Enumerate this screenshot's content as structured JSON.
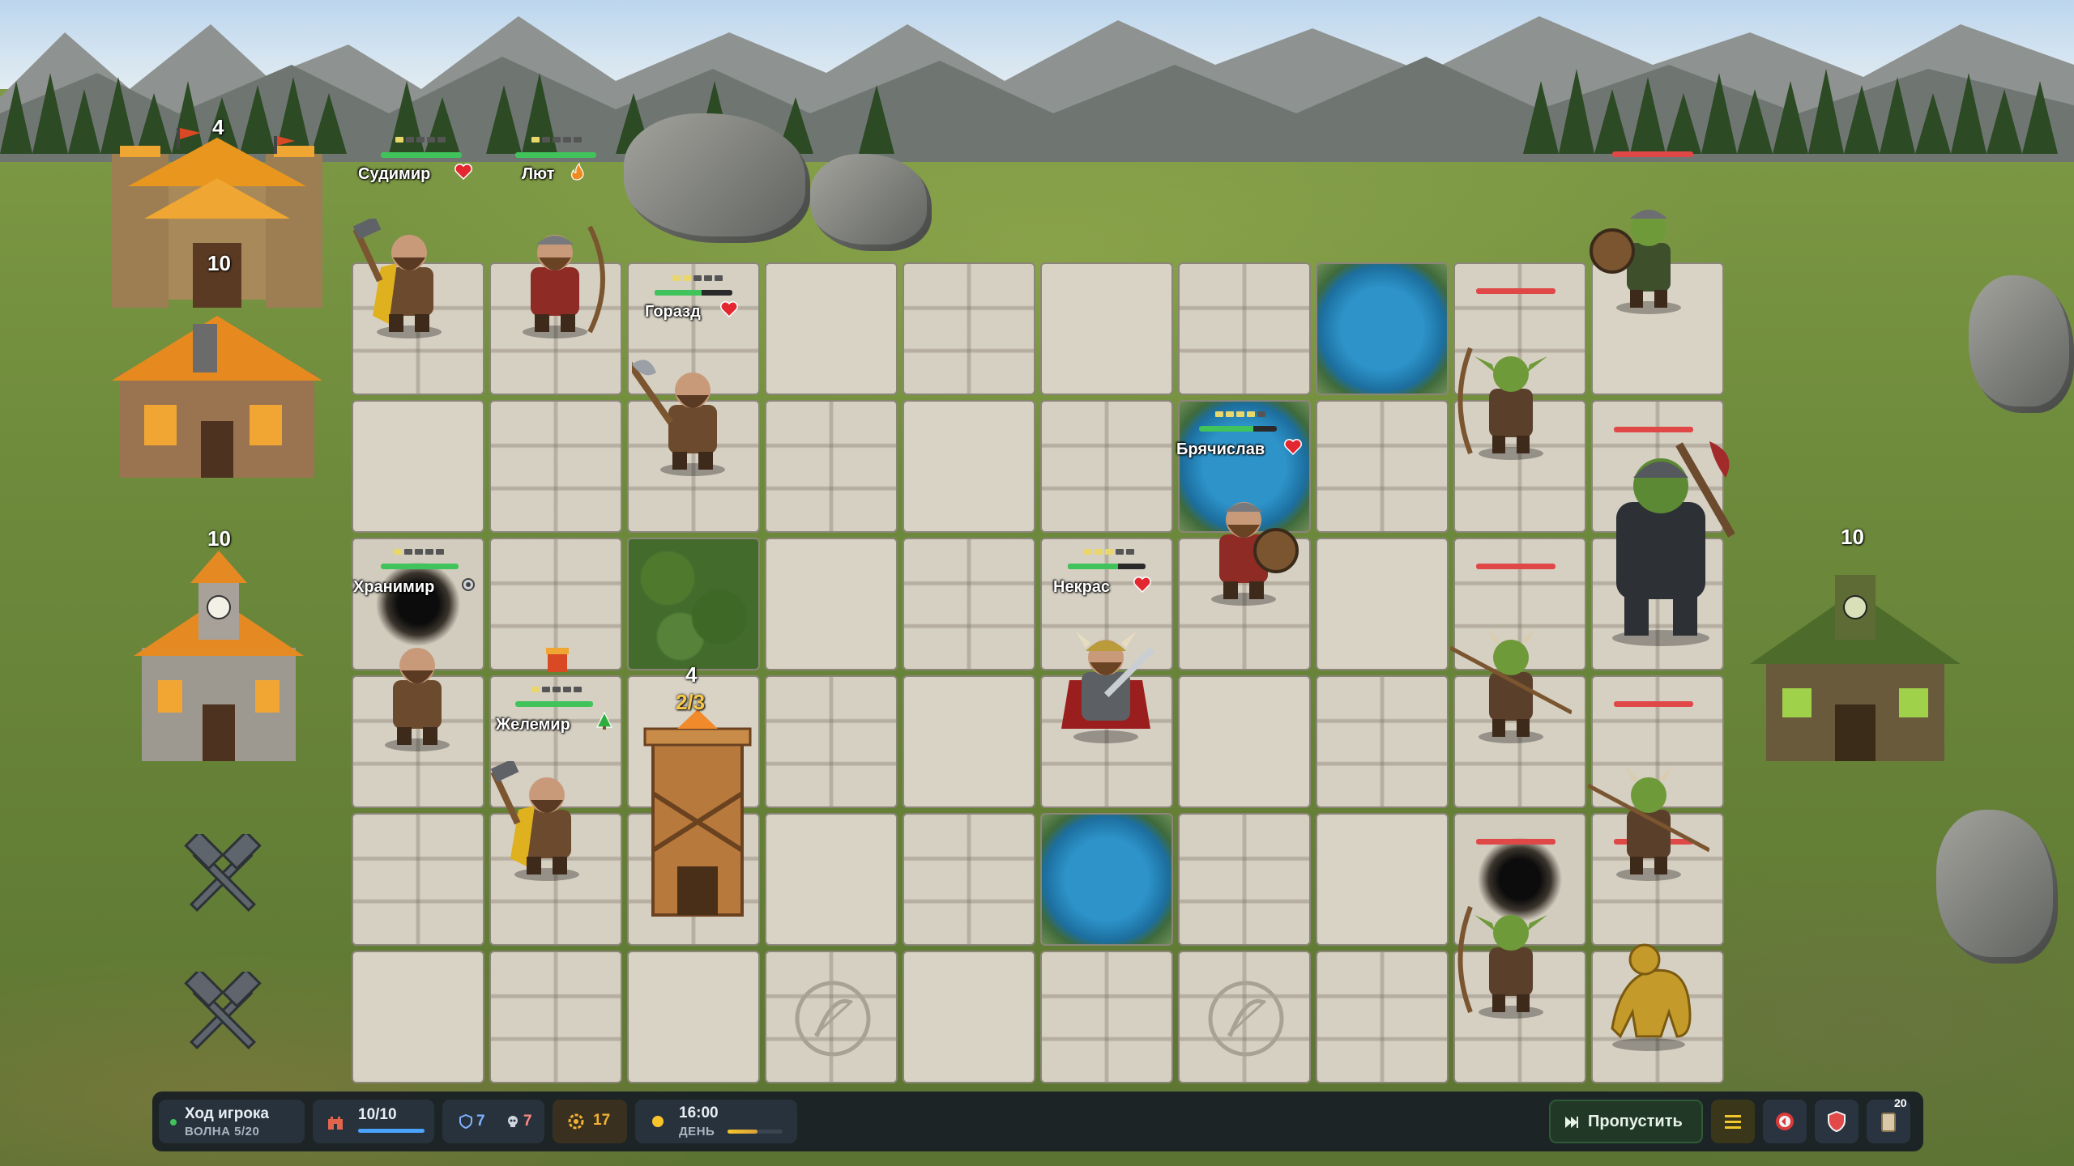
{
  "units": {
    "sudimir": {
      "name": "Судимир"
    },
    "lyut": {
      "name": "Лют"
    },
    "gorazd": {
      "name": "Горазд"
    },
    "bryachislav": {
      "name": "Брячислав"
    },
    "khranimir": {
      "name": "Хранимир"
    },
    "nekras": {
      "name": "Некрас"
    },
    "zhelemir": {
      "name": "Желемир"
    }
  },
  "buildings": {
    "castle_level": "4",
    "workshop_level": "10",
    "townhall_level": "10",
    "enemy_hut_level": "10",
    "tower_level": "4",
    "tower_progress": "2/3"
  },
  "hud": {
    "turn_title": "Ход игрока",
    "wave": "ВОЛНА 5/20",
    "population": "10/10",
    "population_fraction": 1.0,
    "shields": "7",
    "skulls": "7",
    "gold": "17",
    "time": "16:00",
    "phase": "ДЕНЬ",
    "skip_label": "Пропустить",
    "cards_count": "20"
  },
  "colors": {
    "hp_green": "#3fc35a",
    "hp_red": "#e04848",
    "hud_bg": "#171d24",
    "gold": "#f2b233",
    "skip_green": "#3fc35a"
  },
  "icons": {
    "heart": "heart-icon",
    "fire": "fire-icon",
    "tree": "tree-icon",
    "gear": "gear-icon",
    "crossed_hammers": "crossed-hammers-icon"
  }
}
